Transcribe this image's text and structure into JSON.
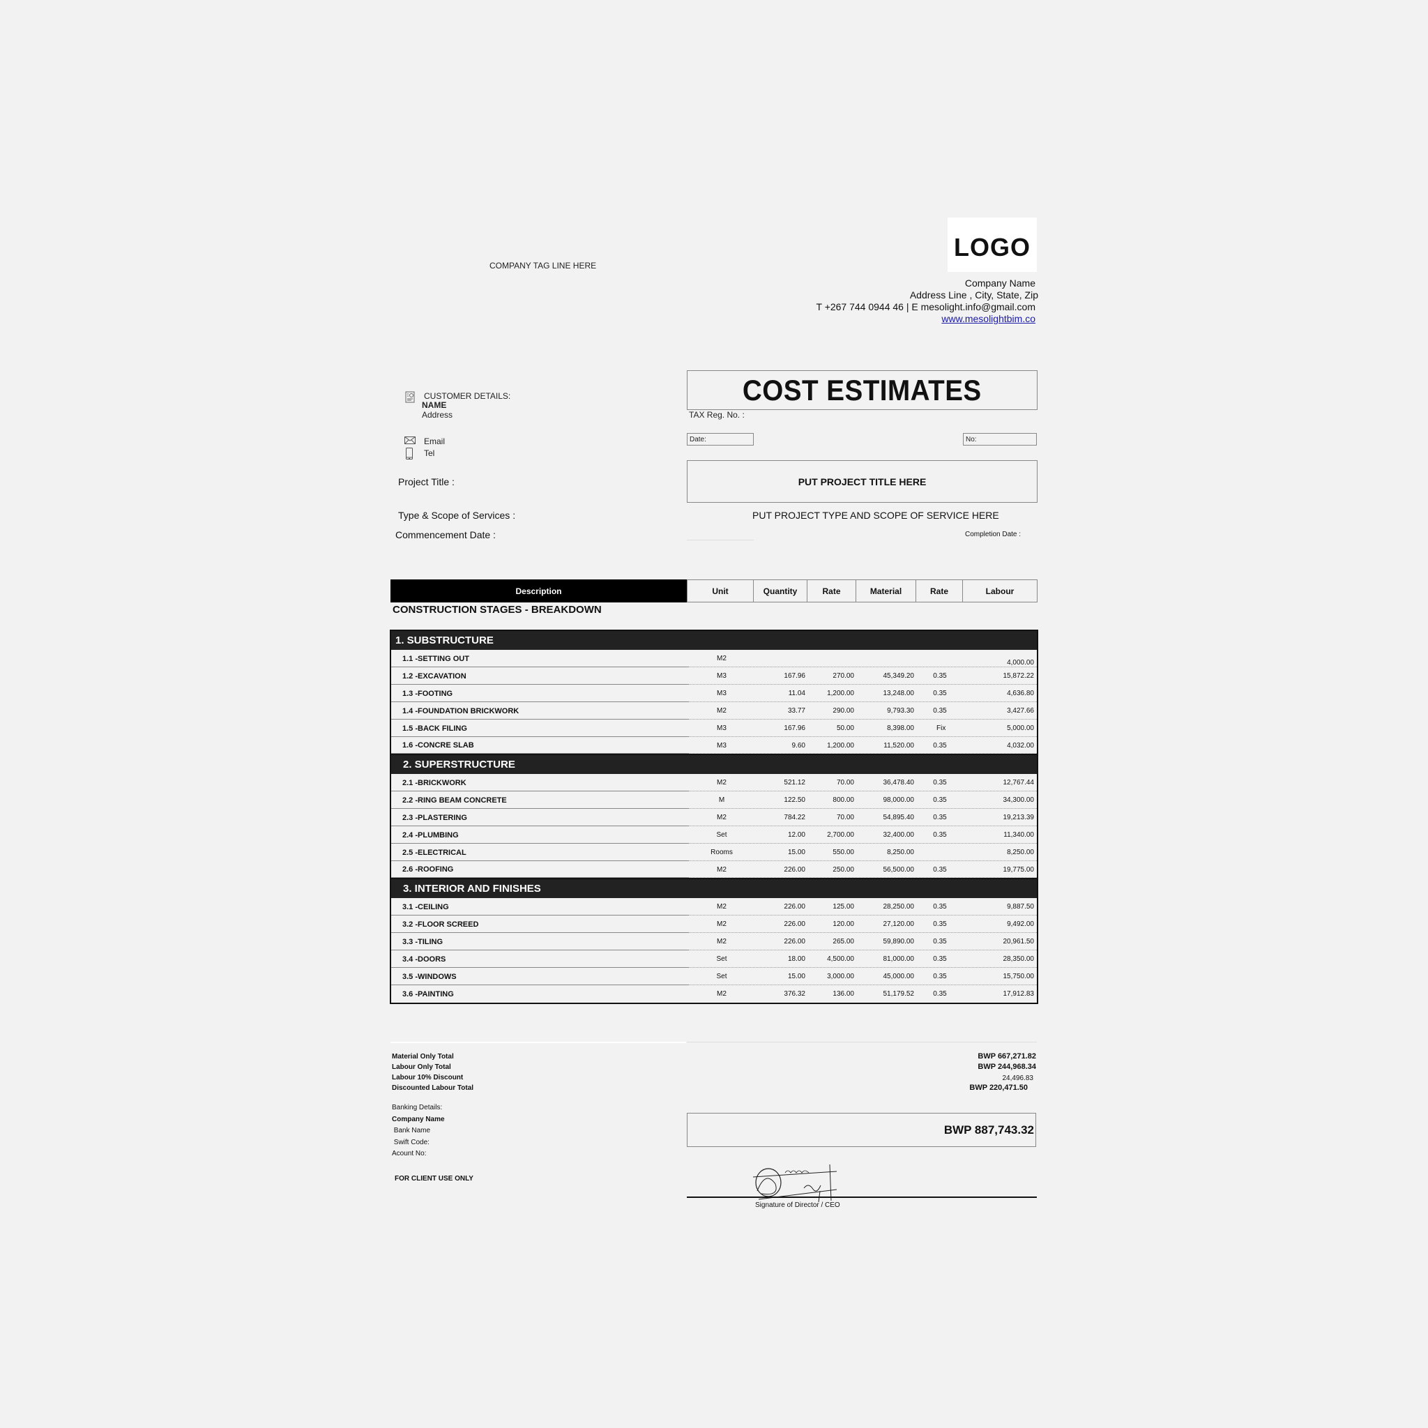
{
  "header": {
    "tagline": "COMPANY TAG LINE HERE",
    "logo_text": "LOGO",
    "company_name": "Company Name",
    "address": "Address Line , City, State, Zip",
    "contact": "T +267 744 0944 46  | E  mesolight.info@gmail.com",
    "website": "www.mesolightbim.co"
  },
  "document": {
    "title": "COST ESTIMATES",
    "tax_reg_label": "TAX Reg. No. :",
    "date_label": "Date:",
    "no_label": "No:"
  },
  "customer": {
    "heading": "CUSTOMER DETAILS:",
    "name": "NAME",
    "address": "Address",
    "email": "Email",
    "tel": "Tel",
    "icons": [
      "contact-card-icon",
      "envelope-icon",
      "phone-icon"
    ]
  },
  "project": {
    "title_label": "Project Title :",
    "title_value": "PUT PROJECT TITLE HERE",
    "scope_label": "Type & Scope of Services :",
    "scope_value": "PUT PROJECT TYPE AND SCOPE OF SERVICE HERE",
    "commencement_label": "Commencement Date :",
    "completion_label": "Completion Date :"
  },
  "table": {
    "columns": [
      "Description",
      "Unit",
      "Quantity",
      "Rate",
      "Material",
      "Rate",
      "Labour"
    ],
    "breakdown_title": "CONSTRUCTION STAGES - BREAKDOWN",
    "sections": [
      {
        "title": "1. SUBSTRUCTURE",
        "rows": [
          {
            "desc": "1.1 -SETTING OUT",
            "unit": "M2",
            "qty": "",
            "rate": "",
            "material": "",
            "lrate": "",
            "labour": "4,000.00"
          },
          {
            "desc": "1.2 -EXCAVATION",
            "unit": "M3",
            "qty": "167.96",
            "rate": "270.00",
            "material": "45,349.20",
            "lrate": "0.35",
            "labour": "15,872.22"
          },
          {
            "desc": "1.3 -FOOTING",
            "unit": "M3",
            "qty": "11.04",
            "rate": "1,200.00",
            "material": "13,248.00",
            "lrate": "0.35",
            "labour": "4,636.80"
          },
          {
            "desc": "1.4 -FOUNDATION BRICKWORK",
            "unit": "M2",
            "qty": "33.77",
            "rate": "290.00",
            "material": "9,793.30",
            "lrate": "0.35",
            "labour": "3,427.66"
          },
          {
            "desc": "1.5 -BACK FILING",
            "unit": "M3",
            "qty": "167.96",
            "rate": "50.00",
            "material": "8,398.00",
            "lrate": "Fix",
            "labour": "5,000.00"
          },
          {
            "desc": "1.6 -CONCRE SLAB",
            "unit": "M3",
            "qty": "9.60",
            "rate": "1,200.00",
            "material": "11,520.00",
            "lrate": "0.35",
            "labour": "4,032.00"
          }
        ]
      },
      {
        "title": "2. SUPERSTRUCTURE",
        "rows": [
          {
            "desc": "2.1 -BRICKWORK",
            "unit": "M2",
            "qty": "521.12",
            "rate": "70.00",
            "material": "36,478.40",
            "lrate": "0.35",
            "labour": "12,767.44"
          },
          {
            "desc": "2.2 -RING BEAM CONCRETE",
            "unit": "M",
            "qty": "122.50",
            "rate": "800.00",
            "material": "98,000.00",
            "lrate": "0.35",
            "labour": "34,300.00"
          },
          {
            "desc": "2.3 -PLASTERING",
            "unit": "M2",
            "qty": "784.22",
            "rate": "70.00",
            "material": "54,895.40",
            "lrate": "0.35",
            "labour": "19,213.39"
          },
          {
            "desc": "2.4 -PLUMBING",
            "unit": "Set",
            "qty": "12.00",
            "rate": "2,700.00",
            "material": "32,400.00",
            "lrate": "0.35",
            "labour": "11,340.00"
          },
          {
            "desc": "2.5 -ELECTRICAL",
            "unit": "Rooms",
            "qty": "15.00",
            "rate": "550.00",
            "material": "8,250.00",
            "lrate": "",
            "labour": "8,250.00"
          },
          {
            "desc": "2.6 -ROOFING",
            "unit": "M2",
            "qty": "226.00",
            "rate": "250.00",
            "material": "56,500.00",
            "lrate": "0.35",
            "labour": "19,775.00"
          }
        ]
      },
      {
        "title": "3. INTERIOR AND FINISHES",
        "rows": [
          {
            "desc": "3.1 -CEILING",
            "unit": "M2",
            "qty": "226.00",
            "rate": "125.00",
            "material": "28,250.00",
            "lrate": "0.35",
            "labour": "9,887.50"
          },
          {
            "desc": "3.2 -FLOOR  SCREED",
            "unit": "M2",
            "qty": "226.00",
            "rate": "120.00",
            "material": "27,120.00",
            "lrate": "0.35",
            "labour": "9,492.00"
          },
          {
            "desc": "3.3 -TILING",
            "unit": "M2",
            "qty": "226.00",
            "rate": "265.00",
            "material": "59,890.00",
            "lrate": "0.35",
            "labour": "20,961.50"
          },
          {
            "desc": "3.4 -DOORS",
            "unit": "Set",
            "qty": "18.00",
            "rate": "4,500.00",
            "material": "81,000.00",
            "lrate": "0.35",
            "labour": "28,350.00"
          },
          {
            "desc": "3.5 -WINDOWS",
            "unit": "Set",
            "qty": "15.00",
            "rate": "3,000.00",
            "material": "45,000.00",
            "lrate": "0.35",
            "labour": "15,750.00"
          },
          {
            "desc": "3.6 -PAINTING",
            "unit": "M2",
            "qty": "376.32",
            "rate": "136.00",
            "material": "51,179.52",
            "lrate": "0.35",
            "labour": "17,912.83"
          }
        ]
      }
    ]
  },
  "totals": {
    "material_label": "Material Only Total",
    "material_value": "BWP 667,271.82",
    "labour_label": "Labour Only Total",
    "labour_value": "BWP 244,968.34",
    "discount_label": "Labour 10% Discount",
    "discount_value": "24,496.83",
    "discounted_label": "Discounted Labour Total",
    "discounted_value": "BWP 220,471.50",
    "grand_total": "BWP 887,743.32"
  },
  "banking": {
    "heading": "Banking Details:",
    "company": "Company Name",
    "bank": " Bank Name",
    "swift": " Swift Code:",
    "account": "Acount No:",
    "client_use": "FOR CLIENT USE ONLY"
  },
  "signature": {
    "label": "Signature of Director / CEO"
  }
}
